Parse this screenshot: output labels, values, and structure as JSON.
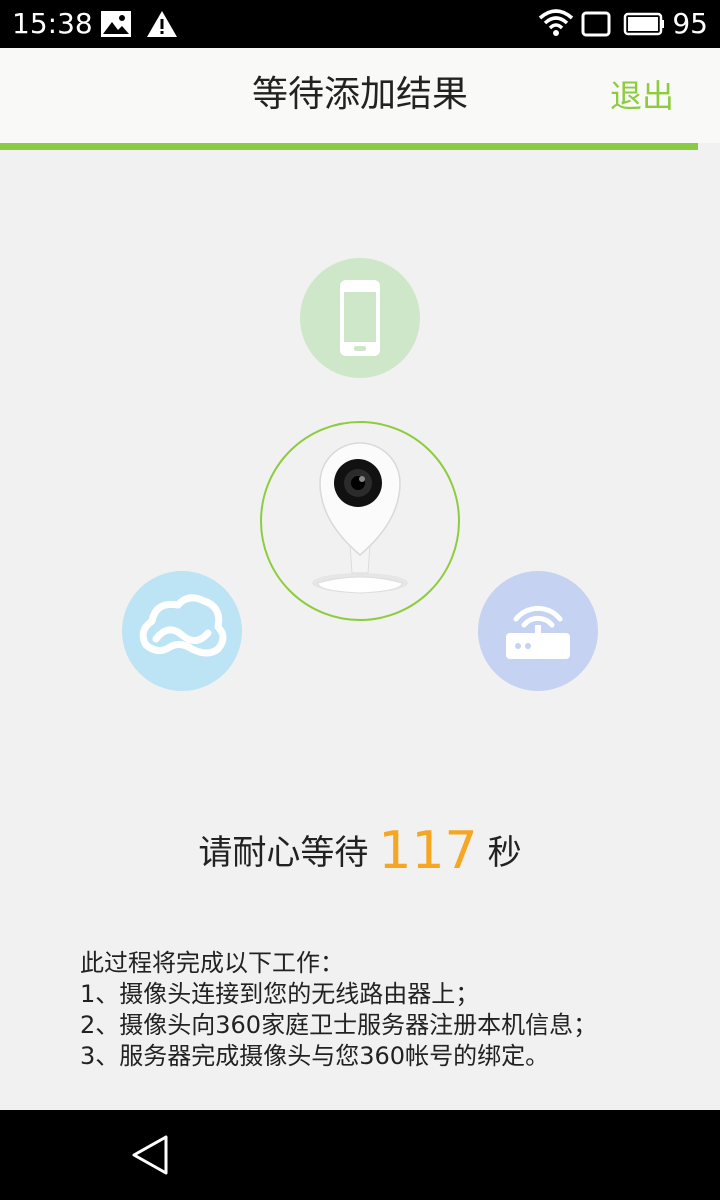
{
  "status_bar": {
    "time": "15:38",
    "icons": [
      "image-icon",
      "warning-icon",
      "wifi-icon",
      "screen-icon",
      "battery-icon"
    ],
    "battery": "95"
  },
  "header": {
    "title": "等待添加结果",
    "exit_label": "退出"
  },
  "wait": {
    "prefix": "请耐心等待",
    "seconds": "117",
    "suffix": "秒"
  },
  "description": {
    "lines": [
      "此过程将完成以下工作：",
      "1、摄像头连接到您的无线路由器上；",
      "2、摄像头向360家庭卫士服务器注册本机信息；",
      "3、服务器完成摄像头与您360帐号的绑定。"
    ]
  },
  "colors": {
    "accent": "#8ccc3e",
    "countdown": "#f5a623",
    "phone_circle": "#cfe7c9",
    "cloud_circle": "#bde4f4",
    "router_circle": "#c5d2f1"
  },
  "nav": {
    "icons": [
      "back-icon"
    ]
  }
}
